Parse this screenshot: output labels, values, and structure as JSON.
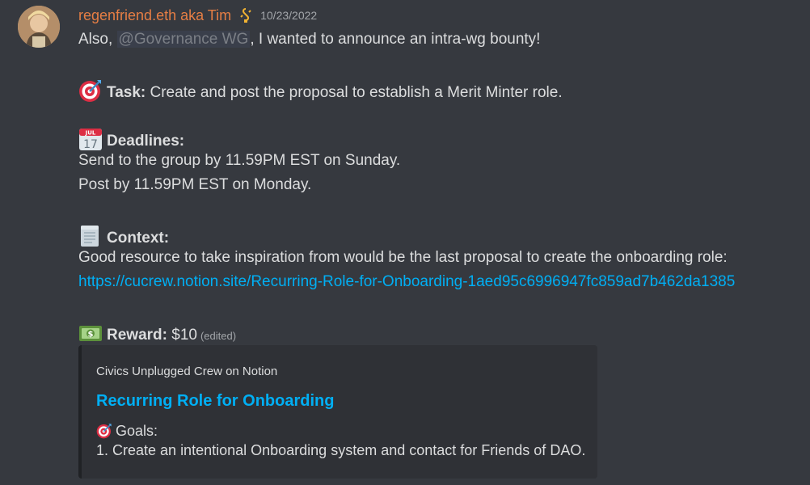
{
  "message": {
    "username": "regenfriend.eth aka Tim",
    "role_icon": "link-badge-icon",
    "timestamp": "10/23/2022",
    "intro_before": "Also, ",
    "intro_mention": "@Governance WG",
    "intro_after": ", I wanted to announce an intra-wg bounty!",
    "task_label": "Task:",
    "task_text": " Create and post the proposal to establish a Merit Minter role.",
    "deadlines_label": "Deadlines:",
    "deadline_1": "Send to the group by 11.59PM EST on Sunday.",
    "deadline_2": "Post by 11.59PM EST on Monday.",
    "context_label": "Context:",
    "context_text": "Good resource to take inspiration from would be the last proposal to create the onboarding role:",
    "context_link": "https://cucrew.notion.site/Recurring-Role-for-Onboarding-1aed95c6996947fc859ad7b462da1385",
    "reward_label": "Reward:",
    "reward_value": " $10",
    "edited": "(edited)",
    "calendar_month": "JUL",
    "calendar_day": "17"
  },
  "embed": {
    "provider": "Civics Unplugged Crew on Notion",
    "title": "Recurring Role for Onboarding",
    "goals_label": "Goals:",
    "goal_1": "1. Create an intentional Onboarding system and contact for Friends of DAO."
  },
  "colors": {
    "background": "#36393f",
    "username": "#e67e44",
    "link": "#00aff4",
    "embed_bg": "#2f3136"
  }
}
